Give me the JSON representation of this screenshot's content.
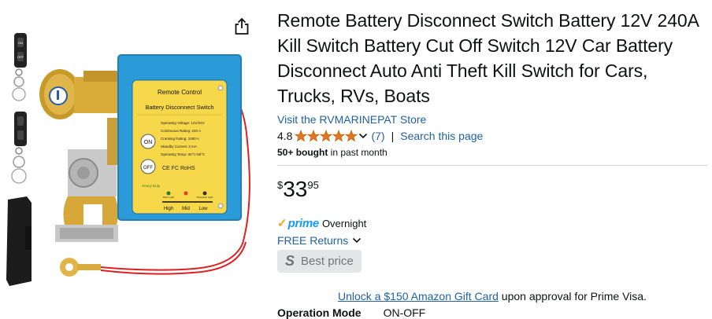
{
  "product": {
    "title": "Remote Battery Disconnect Switch Battery 12V 240A Kill Switch Battery Cut Off Switch 12V Car Battery Disconnect Auto Anti Theft Kill Switch for Cars, Trucks, RVs, Boats",
    "store_link": "Visit the RVMARINEPAT Store",
    "rating_value": "4.8",
    "stars_filled": 5,
    "review_count": "(7)",
    "search_page_link": "Search this page",
    "bought_bold": "50+ bought",
    "bought_rest": " in past month"
  },
  "price": {
    "symbol": "$",
    "whole": "33",
    "fraction": "95"
  },
  "delivery": {
    "prime_label": "prime",
    "prime_speed": "Overnight",
    "returns_label": "FREE Returns",
    "best_price_icon": "S",
    "best_price_label": "Best price"
  },
  "promo": {
    "gift_link": "Unlock a $150 Amazon Gift Card",
    "gift_rest": " upon approval for Prime Visa."
  },
  "spec": {
    "label": "Operation Mode",
    "value": "ON-OFF"
  },
  "image_box": {
    "header1": "Remote Control",
    "header2": "Battery Disconnect Switch",
    "spec1": "Operating Voltage: 12V/24V",
    "spec2": "Continuous Rating: 240 A",
    "spec3": "Cranking Rating: 1000 A",
    "spec4": "Standby Current: 3 mA",
    "spec5": "Operating Temp:-30°C-80°C",
    "on_label": "ON",
    "off_label": "OFF",
    "cert": "CE FC RoHS",
    "heavy": "Heavy Duty",
    "high": "High",
    "mid": "Mid",
    "low": "Low",
    "work_light": "Work Light",
    "protection_light": "Protection Light",
    "remote_on": "ON",
    "remote_off": "OFF"
  },
  "colors": {
    "link": "#2162a1",
    "star": "#de7921",
    "prime": "#1399ff",
    "box_blue": "#2a9bd8",
    "panel_yellow": "#f6d84a"
  },
  "icons": [
    "share-icon",
    "star-icon",
    "chevron-down-icon",
    "prime-check-icon"
  ]
}
